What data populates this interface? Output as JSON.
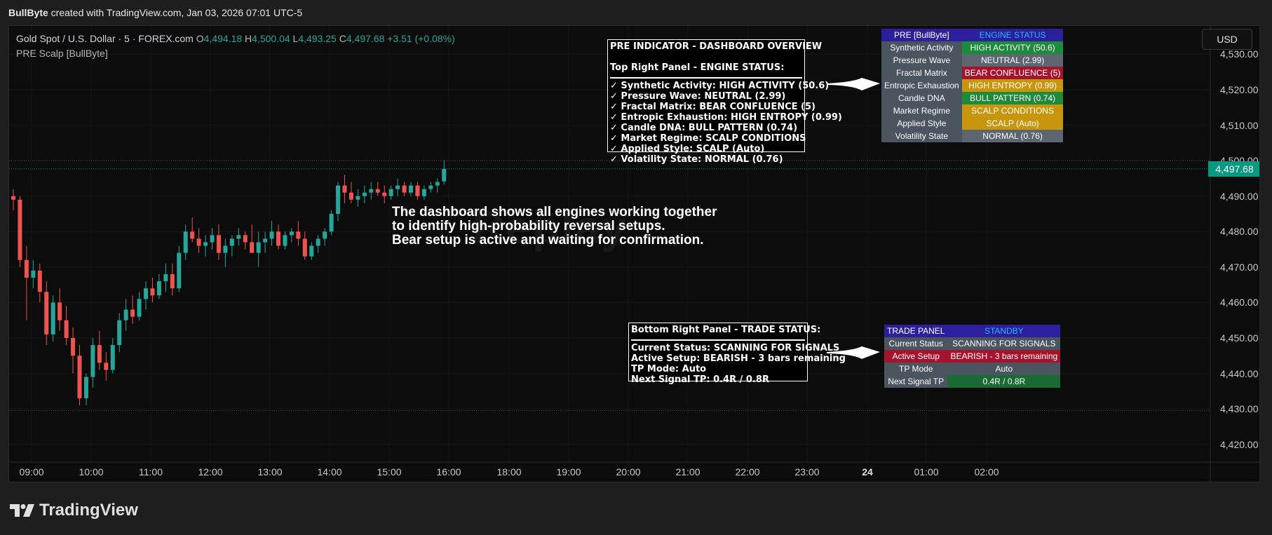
{
  "header": {
    "author": "BullByte",
    "created_text": " created with TradingView.com, Jan 03, 2026 07:01 UTC-5"
  },
  "symbol": {
    "name": "Gold Spot / U.S. Dollar · 5 · FOREX.com",
    "o_label": "O",
    "o_value": "4,494.18",
    "h_label": "H",
    "h_value": "4,500.04",
    "l_label": "L",
    "l_value": "4,493.25",
    "c_label": "C",
    "c_value": "4,497.68",
    "change": "+3.51 (+0.08%)"
  },
  "indicator_name": "PRE Scalp [BullByte]",
  "currency_button": "USD",
  "watermark": "Replay",
  "price_axis": {
    "ticks": [
      "4,530.00",
      "4,520.00",
      "4,510.00",
      "4,500.00",
      "4,490.00",
      "4,480.00",
      "4,470.00",
      "4,460.00",
      "4,450.00",
      "4,440.00",
      "4,430.00",
      "4,420.00"
    ],
    "last_price": "4,497.68"
  },
  "time_axis": {
    "ticks": [
      "09:00",
      "10:00",
      "11:00",
      "12:00",
      "13:00",
      "14:00",
      "15:00",
      "16:00",
      "18:00",
      "19:00",
      "20:00",
      "21:00",
      "22:00",
      "23:00",
      "24",
      "01:00",
      "02:00"
    ]
  },
  "overview_box": {
    "title": "PRE INDICATOR - DASHBOARD OVERVIEW",
    "subtitle": "Top Right Panel - ENGINE STATUS:",
    "items": [
      "✓ Synthetic Activity: HIGH ACTIVITY (50.6)",
      "✓ Pressure Wave: NEUTRAL (2.99)",
      "✓ Fractal Matrix: BEAR CONFLUENCE (5)",
      "✓ Entropic Exhaustion: HIGH ENTROPY (0.99)",
      "✓ Candle DNA: BULL PATTERN (0.74)",
      "✓ Market Regime: SCALP CONDITIONS",
      "✓ Applied Style: SCALP (Auto)",
      "✓ Volatility State: NORMAL (0.76)"
    ]
  },
  "trade_box": {
    "title": "Bottom Right Panel - TRADE STATUS:",
    "items": [
      "Current Status: SCANNING FOR SIGNALS",
      "Active Setup: BEARISH - 3 bars remaining",
      "TP Mode: Auto",
      "Next Signal TP: 0.4R / 0.8R"
    ]
  },
  "center_text": {
    "line1": "The dashboard shows all engines working together",
    "line2": "to identify high-probability reversal setups.",
    "line3": "Bear setup is active and waiting for confirmation."
  },
  "engine_panel": {
    "header_left": "PRE [BullByte]",
    "header_right": "ENGINE STATUS",
    "rows": [
      {
        "label": "Synthetic Activity",
        "value": "HIGH ACTIVITY (50.6)",
        "color": "#1e8a3c"
      },
      {
        "label": "Pressure Wave",
        "value": "NEUTRAL (2.99)",
        "color": "#5d6670"
      },
      {
        "label": "Fractal Matrix",
        "value": "BEAR CONFLUENCE (5)",
        "color": "#a5142d"
      },
      {
        "label": "Entropic Exhaustion",
        "value": "HIGH ENTROPY (0.99)",
        "color": "#c8960c"
      },
      {
        "label": "Candle DNA",
        "value": "BULL PATTERN (0.74)",
        "color": "#1e8a3c"
      },
      {
        "label": "Market Regime",
        "value": "SCALP CONDITIONS",
        "color": "#c8960c"
      },
      {
        "label": "Applied Style",
        "value": "SCALP (Auto)",
        "color": "#c8960c"
      },
      {
        "label": "Volatility State",
        "value": "NORMAL (0.76)",
        "color": "#5d6670"
      }
    ]
  },
  "trade_panel": {
    "header_left": "TRADE PANEL",
    "header_right": "STANDBY",
    "rows": [
      {
        "label": "Current Status",
        "value": "SCANNING FOR SIGNALS",
        "color": "#4a5560",
        "label_color": "#4a5560"
      },
      {
        "label": "Active Setup",
        "value": "BEARISH - 3 bars remaining",
        "color": "#a5142d",
        "label_color": "#a5142d"
      },
      {
        "label": "TP Mode",
        "value": "Auto",
        "color": "#4a5560",
        "label_color": "#4a5560"
      },
      {
        "label": "Next Signal TP",
        "value": "0.4R / 0.8R",
        "color": "#1a6b33",
        "label_color": "#4a5560"
      }
    ]
  },
  "logo_text": "TradingView",
  "colors": {
    "up": "#26a69a",
    "down": "#ef5350",
    "panel_header": "#2b1fa0",
    "panel_header_accent": "#29b6f6"
  },
  "chart_data": {
    "type": "candlestick",
    "title": "Gold Spot / U.S. Dollar · 5 · FOREX.com",
    "ylim": [
      4415,
      4538
    ],
    "candles": [
      [
        4490,
        4492,
        4486,
        4489
      ],
      [
        4489,
        4490,
        4470,
        4472
      ],
      [
        4472,
        4476,
        4455,
        4467
      ],
      [
        4467,
        4472,
        4464,
        4469
      ],
      [
        4469,
        4471,
        4460,
        4463
      ],
      [
        4463,
        4466,
        4448,
        4451
      ],
      [
        4451,
        4462,
        4449,
        4460
      ],
      [
        4460,
        4464,
        4452,
        4455
      ],
      [
        4455,
        4459,
        4448,
        4450
      ],
      [
        4450,
        4453,
        4440,
        4445
      ],
      [
        4445,
        4448,
        4431,
        4433
      ],
      [
        4433,
        4440,
        4431,
        4439
      ],
      [
        4439,
        4450,
        4436,
        4448
      ],
      [
        4448,
        4452,
        4441,
        4443
      ],
      [
        4443,
        4446,
        4438,
        4441
      ],
      [
        4441,
        4450,
        4440,
        4448
      ],
      [
        4448,
        4457,
        4446,
        4455
      ],
      [
        4455,
        4461,
        4452,
        4458
      ],
      [
        4458,
        4462,
        4454,
        4456
      ],
      [
        4456,
        4463,
        4455,
        4461
      ],
      [
        4461,
        4466,
        4458,
        4464
      ],
      [
        4464,
        4467,
        4460,
        4462
      ],
      [
        4462,
        4468,
        4461,
        4466
      ],
      [
        4466,
        4471,
        4463,
        4468
      ],
      [
        4468,
        4471,
        4462,
        4464
      ],
      [
        4464,
        4476,
        4463,
        4474
      ],
      [
        4474,
        4482,
        4472,
        4480
      ],
      [
        4480,
        4484,
        4477,
        4478
      ],
      [
        4478,
        4481,
        4474,
        4476
      ],
      [
        4476,
        4479,
        4473,
        4477
      ],
      [
        4477,
        4481,
        4475,
        4479
      ],
      [
        4479,
        4482,
        4472,
        4474
      ],
      [
        4474,
        4478,
        4470,
        4476
      ],
      [
        4476,
        4479,
        4473,
        4478
      ],
      [
        4478,
        4481,
        4476,
        4479
      ],
      [
        4479,
        4480,
        4475,
        4477
      ],
      [
        4477,
        4482,
        4474,
        4474
      ],
      [
        4474,
        4480,
        4470,
        4477
      ],
      [
        4477,
        4480,
        4474,
        4478
      ],
      [
        4478,
        4483,
        4476,
        4480
      ],
      [
        4480,
        4482,
        4475,
        4476
      ],
      [
        4476,
        4480,
        4475,
        4479
      ],
      [
        4479,
        4481,
        4477,
        4480
      ],
      [
        4480,
        4483,
        4476,
        4478
      ],
      [
        4478,
        4480,
        4472,
        4473
      ],
      [
        4473,
        4477,
        4472,
        4476
      ],
      [
        4476,
        4479,
        4474,
        4478
      ],
      [
        4478,
        4481,
        4476,
        4480
      ],
      [
        4480,
        4486,
        4479,
        4485
      ],
      [
        4485,
        4494,
        4483,
        4493
      ],
      [
        4493,
        4496,
        4488,
        4491
      ],
      [
        4491,
        4494,
        4488,
        4489
      ],
      [
        4489,
        4492,
        4487,
        4490
      ],
      [
        4490,
        4493,
        4488,
        4491
      ],
      [
        4491,
        4494,
        4489,
        4492
      ],
      [
        4492,
        4494,
        4490,
        4491
      ],
      [
        4491,
        4493,
        4488,
        4490
      ],
      [
        4490,
        4493,
        4489,
        4492
      ],
      [
        4492,
        4495,
        4490,
        4493
      ],
      [
        4493,
        4494,
        4490,
        4491
      ],
      [
        4491,
        4494,
        4490,
        4493
      ],
      [
        4493,
        4494,
        4489,
        4490
      ],
      [
        4490,
        4493,
        4489,
        4492
      ],
      [
        4492,
        4494,
        4491,
        4493
      ],
      [
        4493,
        4495,
        4491,
        4494
      ],
      [
        4494.18,
        4500.04,
        4493.25,
        4497.68
      ]
    ]
  }
}
